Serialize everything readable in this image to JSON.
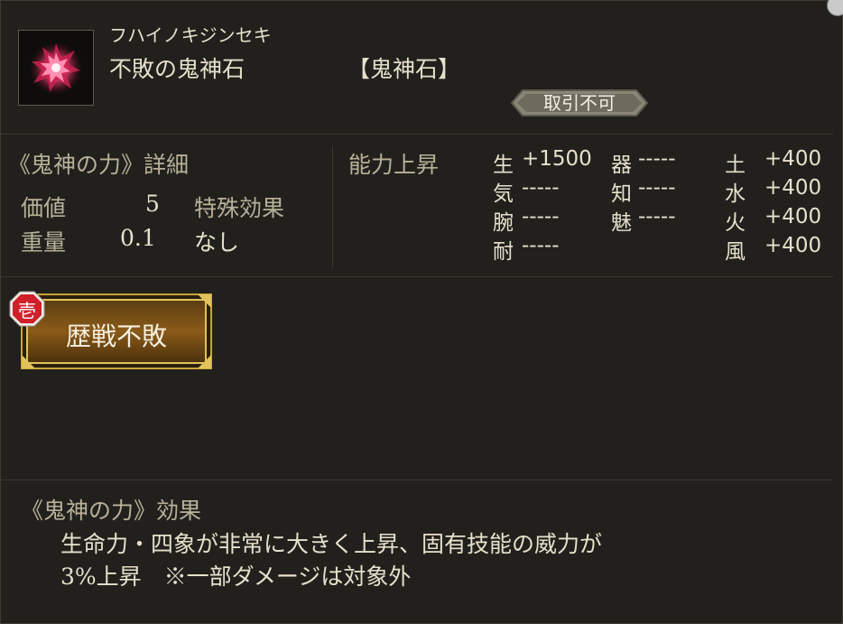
{
  "item": {
    "reading": "フハイノキジンセキ",
    "name": "不敗の鬼神石",
    "type": "【鬼神石】",
    "trade_status": "取引不可",
    "icon": "red-crystal-stone-icon"
  },
  "details": {
    "heading": "《鬼神の力》詳細",
    "value_label": "価値",
    "value": "5",
    "special_label": "特殊効果",
    "weight_label": "重量",
    "weight": "0.1",
    "special_value": "なし"
  },
  "ability": {
    "heading": "能力上昇",
    "rows": [
      [
        {
          "k": "生",
          "v": "+1500"
        },
        {
          "k": "器",
          "v": "-----"
        },
        {
          "k": "土",
          "v": "+400"
        }
      ],
      [
        {
          "k": "気",
          "v": "-----"
        },
        {
          "k": "知",
          "v": "-----"
        },
        {
          "k": "水",
          "v": "+400"
        }
      ],
      [
        {
          "k": "腕",
          "v": "-----"
        },
        {
          "k": "魅",
          "v": "-----"
        },
        {
          "k": "火",
          "v": "+400"
        }
      ],
      [
        {
          "k": "耐",
          "v": "-----"
        },
        {
          "k": "",
          "v": ""
        },
        {
          "k": "風",
          "v": "+400"
        }
      ]
    ]
  },
  "skill": {
    "badge": "壱",
    "label": "歴戦不敗"
  },
  "effect": {
    "heading": "《鬼神の力》効果",
    "line1": "生命力・四象が非常に大きく上昇、固有技能の威力が",
    "line2": "3%上昇　※一部ダメージは対象外"
  },
  "colors": {
    "panel_bg": "#21201c",
    "text": "#e6e0cc",
    "skill_gold": "#c9a53a",
    "badge_red": "#d0202a"
  }
}
